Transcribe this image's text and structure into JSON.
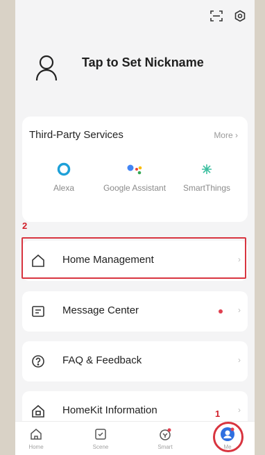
{
  "header": {
    "scan_icon": "scan-icon",
    "settings_icon": "settings-icon"
  },
  "profile": {
    "nickname": "Tap to Set Nickname"
  },
  "third_party": {
    "title": "Third-Party Services",
    "more": "More",
    "services": [
      {
        "name": "Alexa",
        "icon": "alexa-icon"
      },
      {
        "name": "Google Assistant",
        "icon": "google-assistant-icon"
      },
      {
        "name": "SmartThings",
        "icon": "smartthings-icon"
      }
    ]
  },
  "annotations": {
    "marker_1": "1",
    "marker_2": "2"
  },
  "menu": [
    {
      "label": "Home Management",
      "icon": "home-icon"
    },
    {
      "label": "Message Center",
      "icon": "message-icon",
      "has_dot": true
    },
    {
      "label": "FAQ & Feedback",
      "icon": "help-icon"
    },
    {
      "label": "HomeKit Information",
      "icon": "homekit-icon"
    }
  ],
  "tabs": [
    {
      "label": "Home",
      "icon": "home-tab-icon"
    },
    {
      "label": "Scene",
      "icon": "scene-tab-icon"
    },
    {
      "label": "Smart",
      "icon": "smart-tab-icon"
    },
    {
      "label": "Me",
      "icon": "me-tab-icon",
      "active": true
    }
  ],
  "colors": {
    "annotation_red": "#d8343f",
    "active_blue": "#2f6fe0",
    "notification_dot": "#e04050"
  }
}
